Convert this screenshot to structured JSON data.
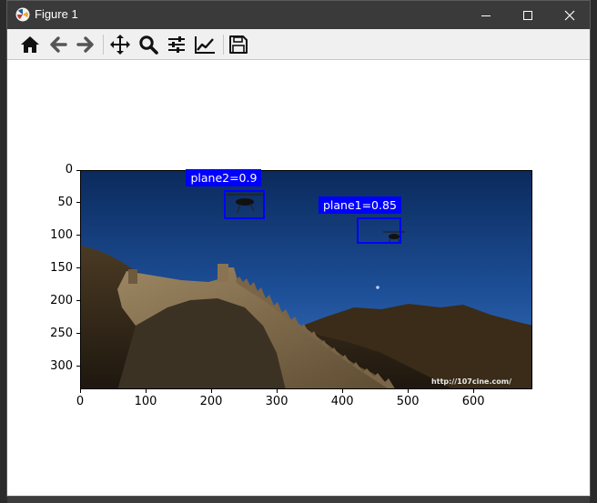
{
  "window": {
    "title": "Figure 1",
    "controls": {
      "minimize": "minimize",
      "maximize": "maximize",
      "close": "close"
    }
  },
  "toolbar": {
    "buttons": [
      {
        "name": "home",
        "icon": "home-icon"
      },
      {
        "name": "back",
        "icon": "arrow-left-icon"
      },
      {
        "name": "forward",
        "icon": "arrow-right-icon"
      },
      {
        "name": "pan",
        "icon": "move-icon"
      },
      {
        "name": "zoom",
        "icon": "magnifier-icon"
      },
      {
        "name": "configure-subplots",
        "icon": "sliders-icon"
      },
      {
        "name": "edit-axis",
        "icon": "line-chart-icon"
      },
      {
        "name": "save",
        "icon": "floppy-disk-icon"
      }
    ]
  },
  "chart_data": {
    "type": "image",
    "xlim": [
      0,
      690
    ],
    "ylim": [
      335,
      0
    ],
    "x_ticks": [
      0,
      100,
      200,
      300,
      400,
      500,
      600
    ],
    "y_ticks": [
      0,
      50,
      100,
      150,
      200,
      250,
      300
    ],
    "detections": [
      {
        "label": "plane2=0.9",
        "x0": 220,
        "y0": 30,
        "x1": 282,
        "y1": 75
      },
      {
        "label": "plane1=0.85",
        "x0": 422,
        "y0": 72,
        "x1": 490,
        "y1": 112
      }
    ],
    "watermark": "http://107cine.com/",
    "colors": {
      "box": "#0000ff",
      "label_text": "#ffffff"
    }
  }
}
